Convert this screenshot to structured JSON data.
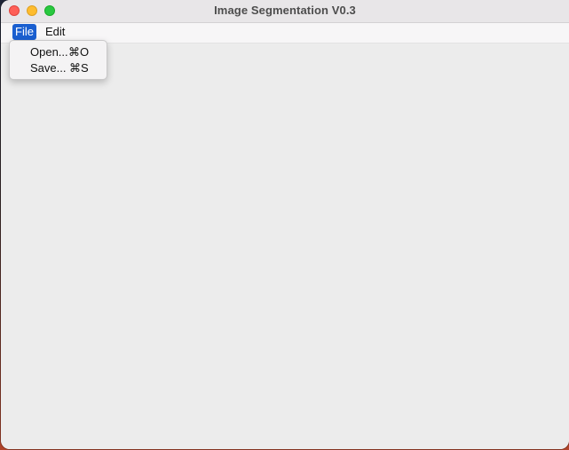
{
  "window": {
    "title": "Image Segmentation V0.3"
  },
  "menubar": {
    "items": [
      {
        "label": "File",
        "active": true
      },
      {
        "label": "Edit",
        "active": false
      }
    ]
  },
  "file_menu": {
    "items": [
      {
        "label": "Open...",
        "shortcut": "⌘O"
      },
      {
        "label": "Save...",
        "shortcut": "⌘S"
      }
    ]
  },
  "colors": {
    "active_menu_bg": "#1a5fd0",
    "content_bg": "#ececec",
    "close": "#fe5f57",
    "minimize": "#febc2e",
    "maximize": "#28c840"
  }
}
